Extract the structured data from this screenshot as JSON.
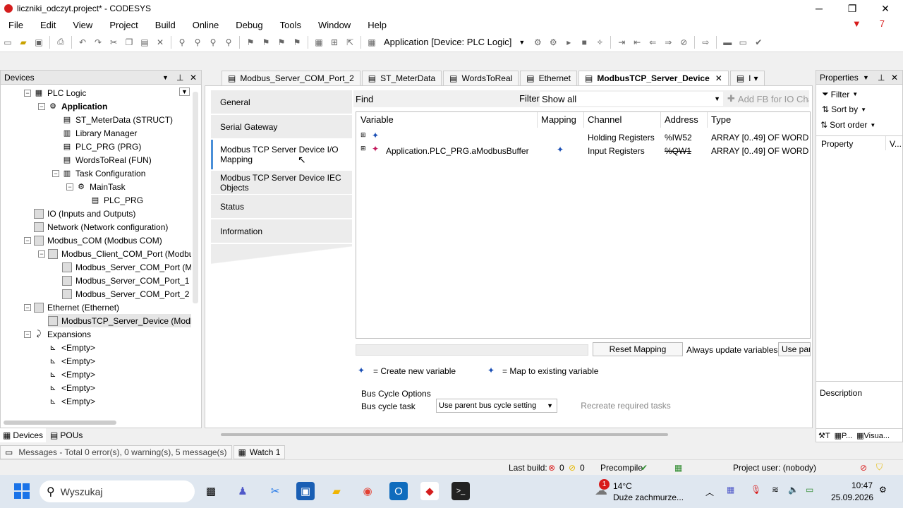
{
  "window": {
    "title": "liczniki_odczyt.project* - CODESYS",
    "minimize": "─",
    "maximize": "❐",
    "close": "✕"
  },
  "menu": [
    "File",
    "Edit",
    "View",
    "Project",
    "Build",
    "Online",
    "Debug",
    "Tools",
    "Window",
    "Help"
  ],
  "menu_badge": "7",
  "toolbar": {
    "app_selector": "Application [Device: PLC Logic]"
  },
  "devices_panel": {
    "title": "Devices",
    "tree": [
      {
        "label": "PLC Logic",
        "indent": 1
      },
      {
        "label": "Application",
        "indent": 2,
        "bold": true
      },
      {
        "label": "ST_MeterData (STRUCT)",
        "indent": 3
      },
      {
        "label": "Library Manager",
        "indent": 3
      },
      {
        "label": "PLC_PRG (PRG)",
        "indent": 3
      },
      {
        "label": "WordsToReal (FUN)",
        "indent": 3
      },
      {
        "label": "Task Configuration",
        "indent": 3
      },
      {
        "label": "MainTask",
        "indent": 4
      },
      {
        "label": "PLC_PRG",
        "indent": 5
      },
      {
        "label": "IO (Inputs and Outputs)",
        "indent": 1
      },
      {
        "label": "Network (Network configuration)",
        "indent": 1
      },
      {
        "label": "Modbus_COM (Modbus COM)",
        "indent": 1
      },
      {
        "label": "Modbus_Client_COM_Port (Modbus",
        "indent": 2
      },
      {
        "label": "Modbus_Server_COM_Port (M",
        "indent": 3
      },
      {
        "label": "Modbus_Server_COM_Port_1",
        "indent": 3
      },
      {
        "label": "Modbus_Server_COM_Port_2",
        "indent": 3
      },
      {
        "label": "Ethernet (Ethernet)",
        "indent": 1
      },
      {
        "label": "ModbusTCP_Server_Device (Modb",
        "indent": 2,
        "selected": true
      },
      {
        "label": "Expansions",
        "indent": 1
      },
      {
        "label": "<Empty>",
        "indent": 2
      },
      {
        "label": "<Empty>",
        "indent": 2
      },
      {
        "label": "<Empty>",
        "indent": 2
      },
      {
        "label": "<Empty>",
        "indent": 2
      },
      {
        "label": "<Empty>",
        "indent": 2
      }
    ],
    "bottom_tabs": [
      "Devices",
      "POUs"
    ]
  },
  "editor_tabs": [
    {
      "label": "Modbus_Server_COM_Port_2"
    },
    {
      "label": "ST_MeterData"
    },
    {
      "label": "WordsToReal"
    },
    {
      "label": "Ethernet"
    },
    {
      "label": "ModbusTCP_Server_Device",
      "active": true
    },
    {
      "label": "I"
    }
  ],
  "side_tabs": [
    "General",
    "Serial Gateway",
    "Modbus TCP Server Device I/O Mapping",
    "Modbus TCP Server Device IEC Objects",
    "Status",
    "Information"
  ],
  "find": {
    "label": "Find",
    "filter_label": "Filter",
    "filter_value": "Show all",
    "add_fb": "Add FB for IO Char"
  },
  "grid": {
    "headers": [
      "Variable",
      "Mapping",
      "Channel",
      "Address",
      "Type"
    ],
    "rows": [
      {
        "variable": "",
        "mapping": "",
        "channel": "Holding Registers",
        "address": "%IW52",
        "type": "ARRAY [0..49] OF WORD"
      },
      {
        "variable": "Application.PLC_PRG.aModbusBuffer",
        "mapping": "map",
        "channel": "Input Registers",
        "address": "%QW1",
        "type": "ARRAY [0..49] OF WORD"
      }
    ]
  },
  "mapping_controls": {
    "reset": "Reset Mapping",
    "always_update": "Always update variables",
    "use_parent": "Use par"
  },
  "legend": {
    "create": "= Create new variable",
    "map": "= Map to existing variable"
  },
  "bus_cycle": {
    "title": "Bus Cycle Options",
    "label": "Bus cycle task",
    "value": "Use parent bus cycle setting",
    "recreate": "Recreate required tasks"
  },
  "properties": {
    "title": "Properties",
    "filter": "Filter",
    "sort_by": "Sort by",
    "sort_order": "Sort order",
    "col1": "Property",
    "col2": "V...",
    "description": "Description",
    "tab_t": "T",
    "tab_p": "P...",
    "tab_v": "Visua..."
  },
  "messages": {
    "text": "Messages - Total 0 error(s), 0 warning(s), 5 message(s)",
    "watch": "Watch 1"
  },
  "status": {
    "last_build": "Last build:",
    "errors": "0",
    "warnings": "0",
    "precompile": "Precompile",
    "user": "Project user: (nobody)"
  },
  "taskbar": {
    "search": "Wyszukaj",
    "temp": "14°C",
    "weather": "Duże zachmurze...",
    "time": "10:47",
    "date": "25.09.2026",
    "badge": "1"
  },
  "colors": {
    "accent": "#4a8fd8",
    "selection": "#e5e5e5",
    "error": "#d81b1b",
    "warning": "#e5b800",
    "taskbar": "#dfe7f0"
  }
}
